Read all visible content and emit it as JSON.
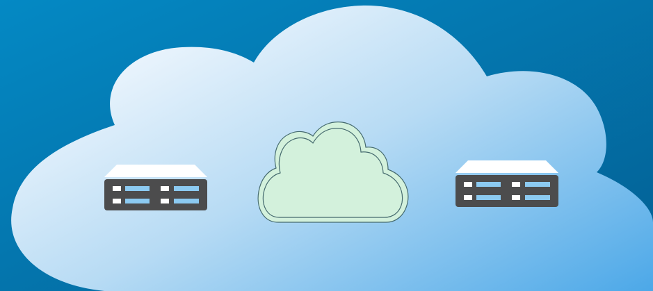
{
  "colors": {
    "background_start": "#0489c4",
    "background_end": "#035f93",
    "cloud_light": "#f4f9fe",
    "cloud_mid": "#b7dbf4",
    "cloud_dark": "#4ca8e8",
    "small_cloud_fill": "#d3f1dc",
    "small_cloud_stroke": "#456a6e",
    "server_body": "#4c4c4d",
    "server_top": "#ffffff",
    "server_slot_white": "#ffffff",
    "server_slot_blue": "#8ccaf1"
  },
  "diagram": {
    "nodes": [
      {
        "id": "server-left",
        "icon": "server-icon"
      },
      {
        "id": "cloud-center",
        "icon": "cloud-icon"
      },
      {
        "id": "server-right",
        "icon": "server-icon"
      }
    ]
  }
}
